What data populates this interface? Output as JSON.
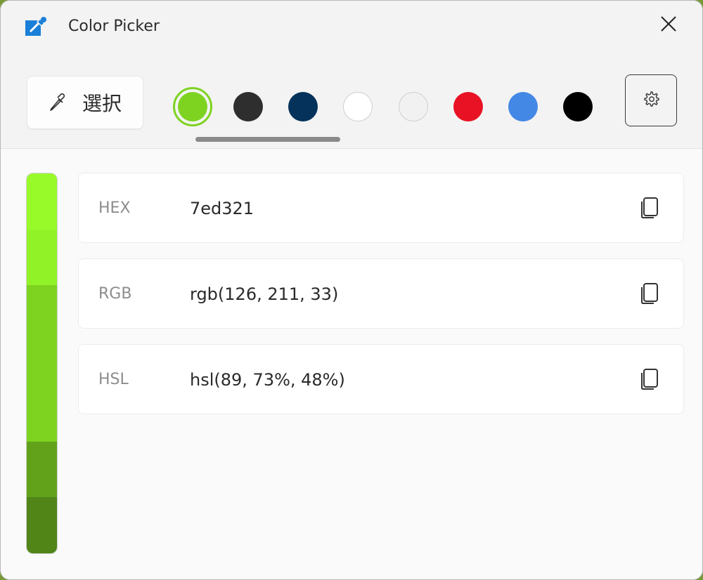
{
  "window": {
    "title": "Color Picker",
    "app_icon": "eyedropper-app-icon",
    "close_icon": "close-icon"
  },
  "toolbar": {
    "select_button_label": "選択",
    "select_button_icon": "eyedropper-icon",
    "settings_icon": "gear-icon",
    "swatches": [
      {
        "name": "green",
        "color": "#7ed321",
        "selected": true
      },
      {
        "name": "dark-gray",
        "color": "#2e2e2e",
        "selected": false
      },
      {
        "name": "navy",
        "color": "#04325b",
        "selected": false
      },
      {
        "name": "white",
        "color": "#ffffff",
        "selected": false
      },
      {
        "name": "light-gray",
        "color": "#f1f1f1",
        "selected": false
      },
      {
        "name": "red",
        "color": "#e81224",
        "selected": false
      },
      {
        "name": "blue",
        "color": "#4488e6",
        "selected": false
      },
      {
        "name": "black",
        "color": "#000000",
        "selected": false
      }
    ]
  },
  "shades": [
    {
      "color": "#99fa2a"
    },
    {
      "color": "#91f227"
    },
    {
      "color": "#7ed321"
    },
    {
      "color": "#62a11a"
    },
    {
      "color": "#518518"
    }
  ],
  "shade_weights": [
    1,
    1,
    2.8,
    1,
    1
  ],
  "formats": [
    {
      "label": "HEX",
      "value": "7ed321",
      "copy_icon": "copy-icon"
    },
    {
      "label": "RGB",
      "value": "rgb(126, 211, 33)",
      "copy_icon": "copy-icon"
    },
    {
      "label": "HSL",
      "value": "hsl(89, 73%, 48%)",
      "copy_icon": "copy-icon"
    }
  ]
}
